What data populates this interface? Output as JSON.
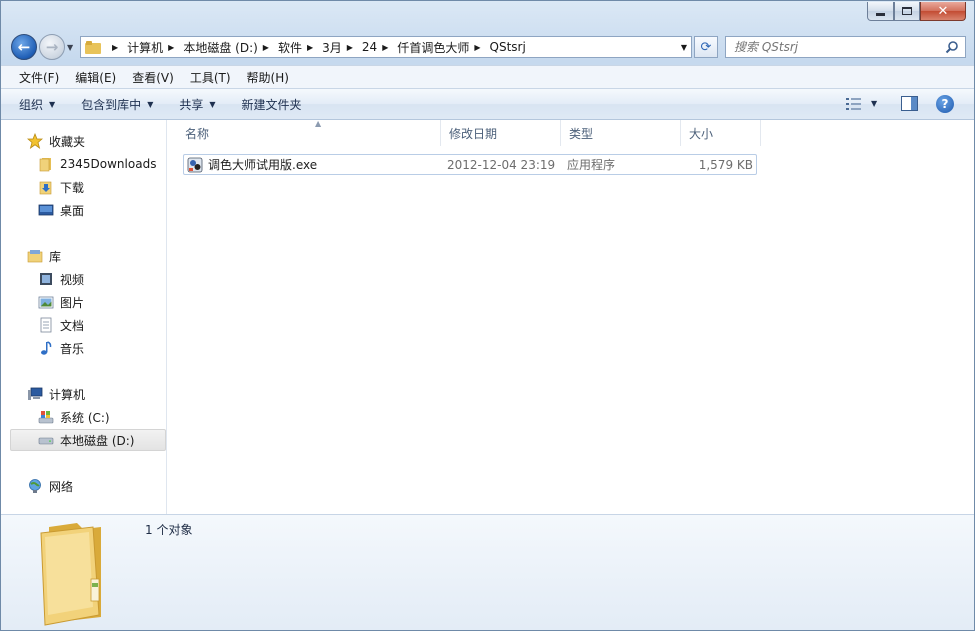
{
  "window": {
    "minimize_label": "–",
    "close_glyph": "✕"
  },
  "nav": {
    "back_glyph": "←",
    "forward_glyph": "→",
    "refresh_glyph": "⟳"
  },
  "address": {
    "crumbs": [
      "计算机",
      "本地磁盘 (D:)",
      "软件",
      "3月",
      "24",
      "仟首调色大师",
      "QStsrj"
    ]
  },
  "search": {
    "placeholder": "搜索 QStsrj"
  },
  "menubar": {
    "items": [
      "文件(F)",
      "编辑(E)",
      "查看(V)",
      "工具(T)",
      "帮助(H)"
    ]
  },
  "cmdbar": {
    "organize": "组织",
    "include_library": "包含到库中",
    "share": "共享",
    "new_folder": "新建文件夹",
    "help_glyph": "?"
  },
  "navpane": {
    "favorites": "收藏夹",
    "fav_items": [
      "2345Downloads",
      "下载",
      "桌面"
    ],
    "libraries": "库",
    "lib_items": [
      "视频",
      "图片",
      "文档",
      "音乐"
    ],
    "computer": "计算机",
    "computer_items": [
      "系统 (C:)",
      "本地磁盘 (D:)"
    ],
    "network": "网络"
  },
  "columns": {
    "name": "名称",
    "date": "修改日期",
    "type": "类型",
    "size": "大小"
  },
  "files": [
    {
      "name": "调色大师试用版.exe",
      "date": "2012-12-04 23:19",
      "type": "应用程序",
      "size": "1,579 KB"
    }
  ],
  "details": {
    "count": "1 个对象"
  },
  "colors": {
    "accent": "#1f5eb5",
    "folder": "#e8c35a",
    "selection_border": "#b9cde6"
  }
}
